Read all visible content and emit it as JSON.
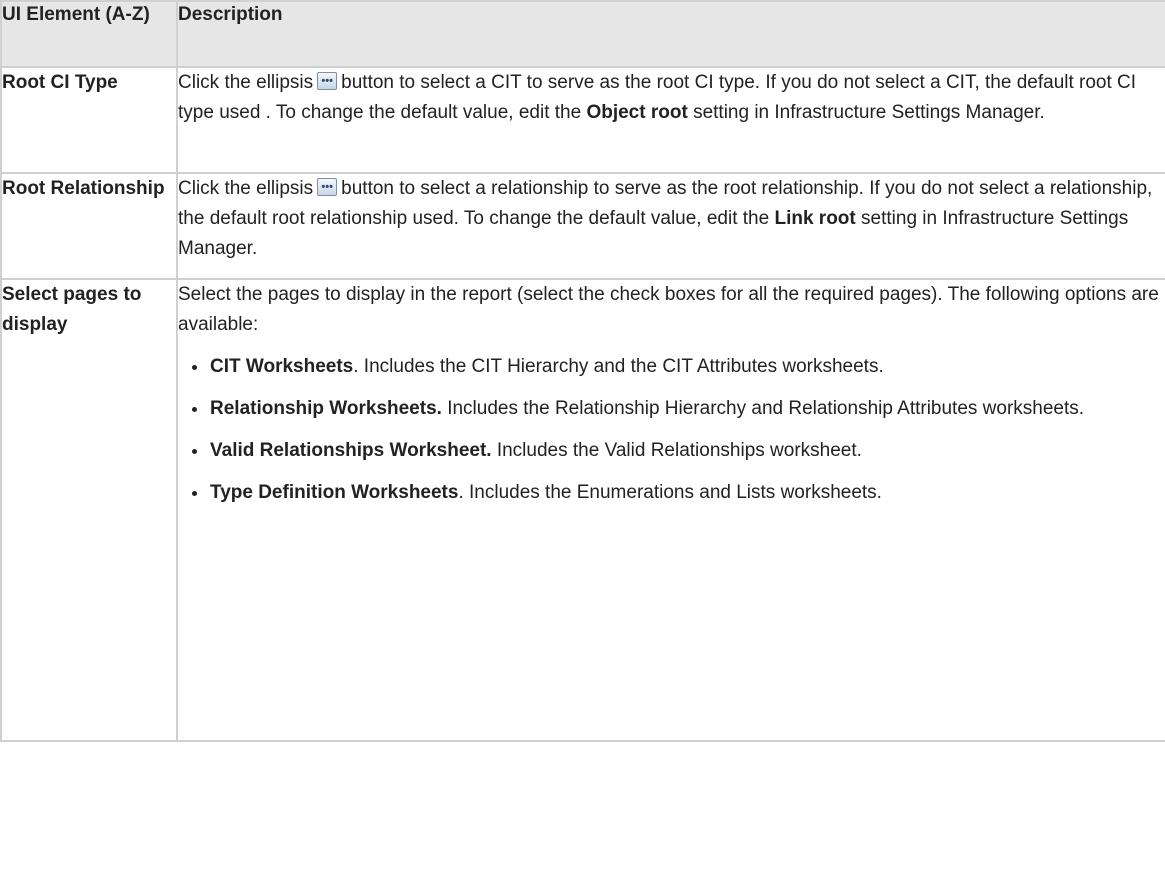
{
  "header": {
    "col1": "UI Element (A-Z)",
    "col2": "Description"
  },
  "rows": [
    {
      "name": "Root CI Type",
      "desc_pre": "Click the ellipsis",
      "desc_post": "button to select a CIT to serve as the root CI type. If you do not select a CIT, the default root CI type used . To change the default value, edit the",
      "bold_term": "Object root",
      "desc_end": "setting in Infrastructure Settings Manager."
    },
    {
      "name": "Root Relationship",
      "desc_pre": "Click the ellipsis",
      "desc_post": "button to select a relationship to serve as the root relationship. If you do not select a relationship, the default root relationship used. To change the default value, edit the",
      "bold_term": "Link root",
      "desc_end": "setting in Infrastructure Settings Manager."
    },
    {
      "name": "Select pages to display",
      "intro": "Select the pages to display in the report (select the check boxes for all the required pages). The following options are available:",
      "options": [
        {
          "term": "CIT Worksheets",
          "text": ". Includes the CIT Hierarchy and the CIT Attributes worksheets."
        },
        {
          "term": "Relationship Worksheets.",
          "text": " Includes the Relationship Hierarchy and Relationship Attributes worksheets."
        },
        {
          "term": "Valid Relationships Worksheet.",
          "text": " Includes the Valid Relationships worksheet."
        },
        {
          "term": "Type Definition Worksheets",
          "text": ". Includes the Enumerations and Lists worksheets."
        }
      ]
    }
  ],
  "icons": {
    "ellipsis_button": "ellipsis-icon"
  }
}
